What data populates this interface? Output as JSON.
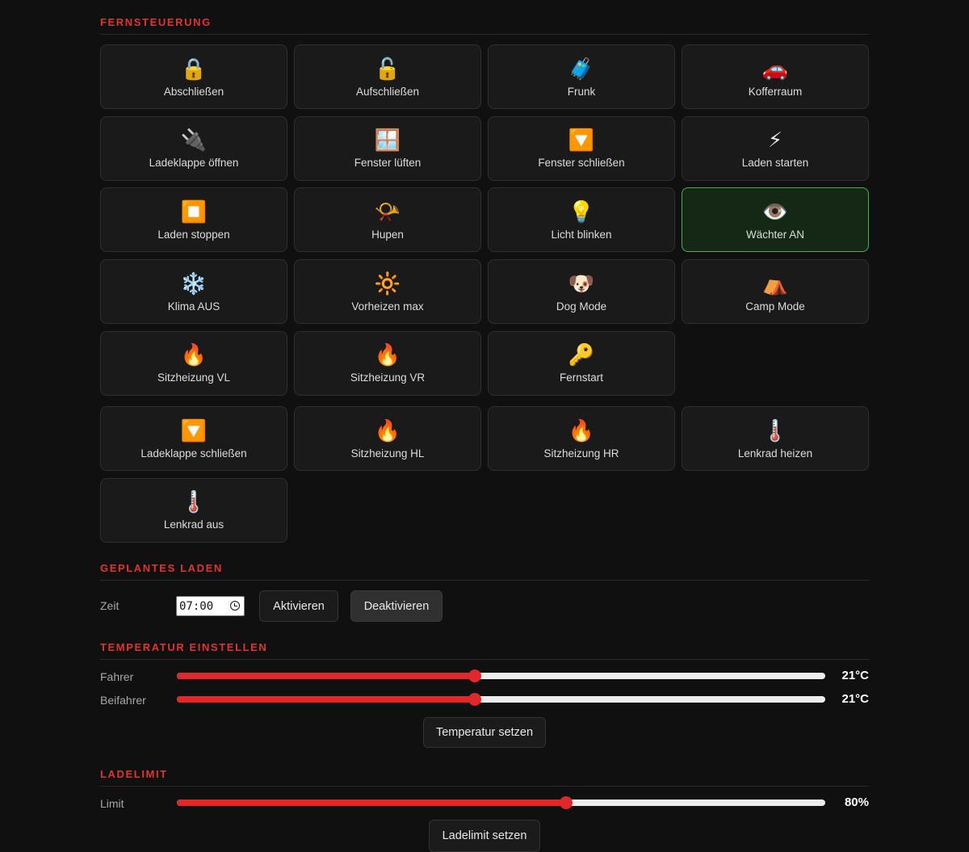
{
  "sections": {
    "remote": "FERNSTEUERUNG",
    "schedule": "GEPLANTES LADEN",
    "temperature": "TEMPERATUR EINSTELLEN",
    "charge_limit": "LADELIMIT"
  },
  "remote_tiles": [
    {
      "label": "Abschließen",
      "icon": "🔒",
      "icon_name": "lock-icon"
    },
    {
      "label": "Aufschließen",
      "icon": "🔓",
      "icon_name": "unlock-icon"
    },
    {
      "label": "Frunk",
      "icon": "🧳",
      "icon_name": "luggage-icon"
    },
    {
      "label": "Kofferraum",
      "icon": "🚗",
      "icon_name": "car-icon"
    },
    {
      "label": "Ladeklappe öffnen",
      "icon": "🔌",
      "icon_name": "plug-icon"
    },
    {
      "label": "Fenster lüften",
      "icon": "🪟",
      "icon_name": "window-icon"
    },
    {
      "label": "Fenster schließen",
      "icon": "🔽",
      "icon_name": "down-button-icon"
    },
    {
      "label": "Laden starten",
      "icon": "⚡",
      "icon_name": "lightning-icon"
    },
    {
      "label": "Laden stoppen",
      "icon": "⏹️",
      "icon_name": "stop-icon"
    },
    {
      "label": "Hupen",
      "icon": "📯",
      "icon_name": "horn-icon"
    },
    {
      "label": "Licht blinken",
      "icon": "💡",
      "icon_name": "light-bulb-icon"
    },
    {
      "label": "Wächter AN",
      "icon": "👁️",
      "icon_name": "eye-icon",
      "active": true
    },
    {
      "label": "Klima AUS",
      "icon": "❄️",
      "icon_name": "snowflake-icon"
    },
    {
      "label": "Vorheizen max",
      "icon": "🔆",
      "icon_name": "sun-icon"
    },
    {
      "label": "Dog Mode",
      "icon": "🐶",
      "icon_name": "dog-icon"
    },
    {
      "label": "Camp Mode",
      "icon": "⛺",
      "icon_name": "tent-icon"
    },
    {
      "label": "Sitzheizung VL",
      "icon": "🔥",
      "icon_name": "fire-icon"
    },
    {
      "label": "Sitzheizung VR",
      "icon": "🔥",
      "icon_name": "fire-icon"
    },
    {
      "label": "Fernstart",
      "icon": "🔑",
      "icon_name": "key-icon"
    }
  ],
  "extra_tiles": [
    {
      "label": "Ladeklappe schließen",
      "icon": "🔽",
      "icon_name": "down-button-icon"
    },
    {
      "label": "Sitzheizung HL",
      "icon": "🔥",
      "icon_name": "fire-icon"
    },
    {
      "label": "Sitzheizung HR",
      "icon": "🔥",
      "icon_name": "fire-icon"
    },
    {
      "label": "Lenkrad heizen",
      "icon": "🌡️",
      "icon_name": "thermometer-icon"
    },
    {
      "label": "Lenkrad aus",
      "icon": "🌡️",
      "icon_name": "thermometer-icon"
    }
  ],
  "schedule": {
    "label": "Zeit",
    "time": "07:00",
    "activate": "Aktivieren",
    "deactivate": "Deaktivieren"
  },
  "temperature": {
    "driver_label": "Fahrer",
    "passenger_label": "Beifahrer",
    "driver_value": "21°C",
    "passenger_value": "21°C",
    "driver_fraction": 0.46,
    "passenger_fraction": 0.46,
    "set_button": "Temperatur setzen"
  },
  "charge_limit": {
    "label": "Limit",
    "value": "80%",
    "fraction": 0.6,
    "set_button": "Ladelimit setzen"
  },
  "colors": {
    "accent": "#e0282a",
    "active_tile_border": "#47b04f"
  }
}
